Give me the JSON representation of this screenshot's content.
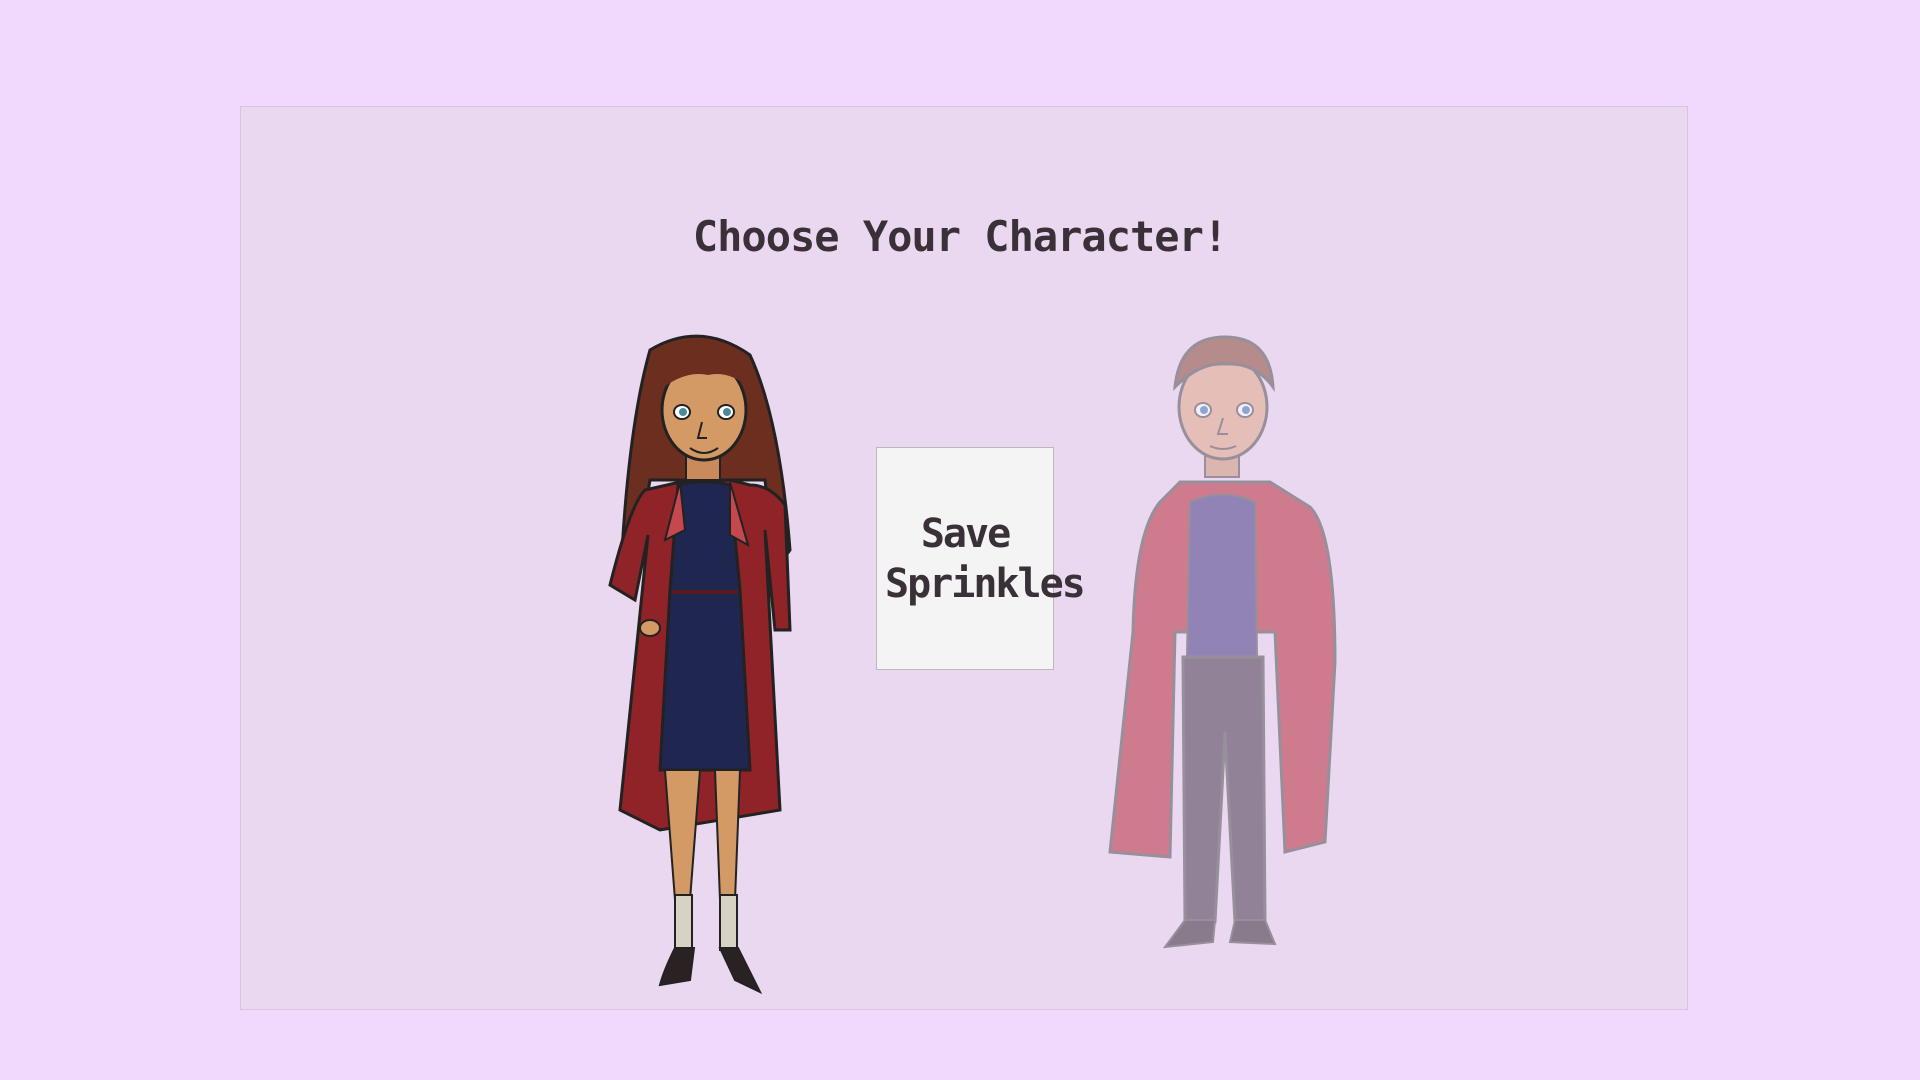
{
  "screen": {
    "title": "Choose Your Character!",
    "save_button_label": "Save Sprinkles"
  },
  "characters": [
    {
      "id": "girl",
      "state": "selected"
    },
    {
      "id": "boy",
      "state": "dimmed"
    }
  ],
  "colors": {
    "background": "#f1d9fd",
    "panel": "#ead8f1",
    "text": "#3a3038",
    "button": "#f4f4f4",
    "coat_red": "#8f2328"
  }
}
